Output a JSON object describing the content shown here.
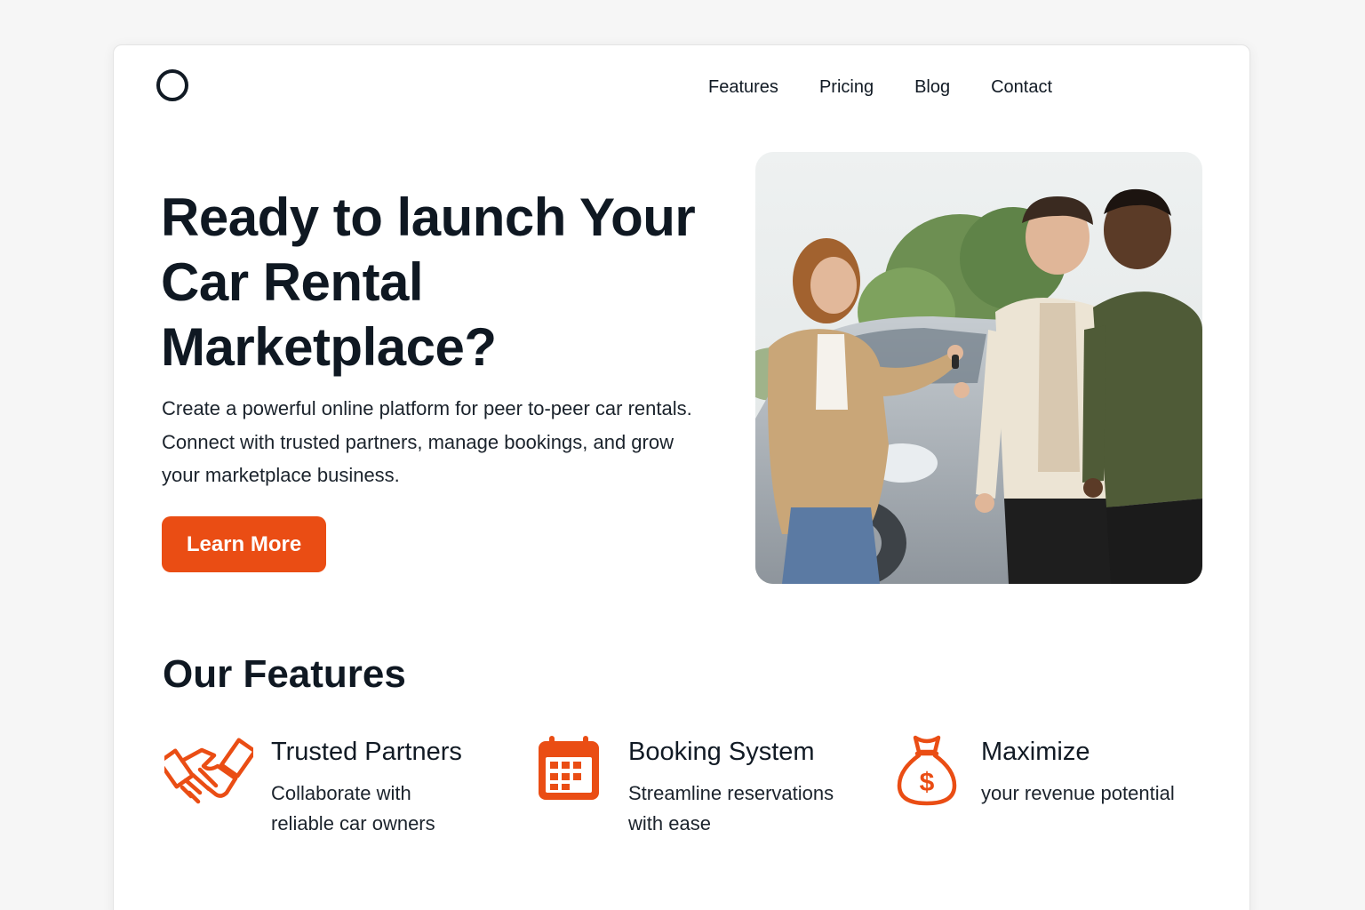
{
  "header": {
    "logo_icon": "circle-logo-icon",
    "nav": [
      "Features",
      "Pricing",
      "Blog",
      "Contact"
    ]
  },
  "hero": {
    "title": "Ready to launch Your Car Rental Marketplace?",
    "description": "Create a powerful online platform for peer to-peer car rentals. Connect with trusted partners, manage bookings, and grow your marketplace business.",
    "cta_label": "Learn More",
    "image_subject": "people-exchanging-car-keys-photo"
  },
  "features": {
    "title": "Our Features",
    "items": [
      {
        "icon": "handshake-icon",
        "title": "Trusted Partners",
        "description": "Collaborate with reliable car owners"
      },
      {
        "icon": "calendar-icon",
        "title": "Booking System",
        "description": "Streamline reservations with ease"
      },
      {
        "icon": "money-bag-icon",
        "title": "Maximize",
        "description": "your revenue potential"
      }
    ]
  },
  "colors": {
    "accent": "#ea4d14",
    "text": "#111a24",
    "background": "#f6f6f6",
    "card": "#ffffff"
  }
}
